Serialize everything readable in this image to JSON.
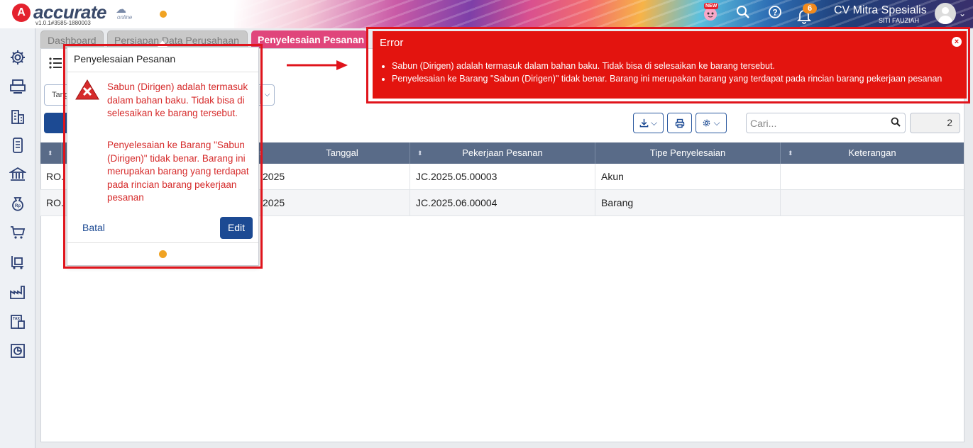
{
  "app": {
    "logo_letter": "A",
    "logo_text": "accurate",
    "logo_sub": "online",
    "version": "v1.0.1#3585-1880003",
    "new_badge": "NEW",
    "notification_count": "6",
    "company_name": "CV Mitra Spesialis",
    "user_name": "SITI FAUZIAH"
  },
  "tabs": [
    {
      "label": "Dashboard"
    },
    {
      "label": "Persiapan Data Perusahaan"
    },
    {
      "label": "Penyelesaian Pesanan"
    }
  ],
  "toolbar": {
    "filter_value": "Tanggal",
    "search_placeholder": "Cari...",
    "record_count": "2"
  },
  "table": {
    "columns": [
      "Tanggal",
      "Pekerjaan Pesanan",
      "Tipe Penyelesaian",
      "Keterangan"
    ],
    "rows": [
      {
        "no": "RO.",
        "tanggal": "2025",
        "pekerjaan": "JC.2025.05.00003",
        "tipe": "Akun",
        "keterangan": ""
      },
      {
        "no": "RO.",
        "tanggal": "2025",
        "pekerjaan": "JC.2025.06.00004",
        "tipe": "Barang",
        "keterangan": ""
      }
    ]
  },
  "popup": {
    "title": "Penyelesaian Pesanan",
    "message_1": "Sabun (Dirigen) adalah termasuk dalam bahan baku. Tidak bisa di selesaikan ke barang tersebut.",
    "message_2": "Penyelesaian ke Barang \"Sabun (Dirigen)\" tidak benar. Barang ini merupakan barang yang terdapat pada rincian barang pekerjaan pesanan",
    "cancel_label": "Batal",
    "edit_label": "Edit"
  },
  "error": {
    "title": "Error",
    "items": [
      "Sabun (Dirigen) adalah termasuk dalam bahan baku. Tidak bisa di selesaikan ke barang tersebut.",
      "Penyelesaian ke Barang \"Sabun (Dirigen)\" tidak benar. Barang ini merupakan barang yang terdapat pada rincian barang pekerjaan pesanan"
    ]
  },
  "colors": {
    "brand_red": "#e4222e",
    "primary_blue": "#1c4a93",
    "active_tab": "#e0457b",
    "error_red": "#e3140f",
    "table_header": "#596b88"
  },
  "icons": [
    "settings-icon",
    "print-stand-icon",
    "building-icon",
    "device-icon",
    "bank-icon",
    "money-bag-icon",
    "cart-icon",
    "trolley-icon",
    "factory-icon",
    "tax-icon",
    "report-icon",
    "search-icon",
    "help-icon",
    "bell-icon",
    "download-icon",
    "printer-icon",
    "gear-icon",
    "list-icon",
    "error-icon",
    "close-icon"
  ]
}
